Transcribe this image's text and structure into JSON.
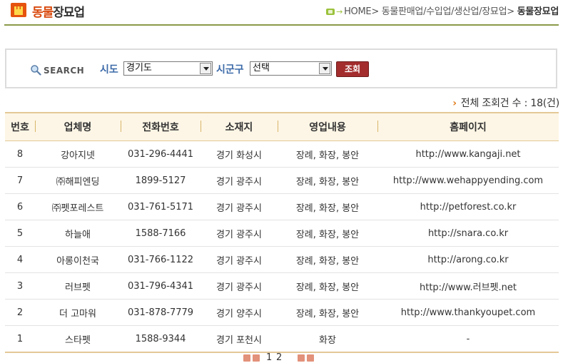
{
  "header": {
    "title_part1": "동물",
    "title_part2": "장묘업",
    "breadcrumb": [
      "HOME",
      "동물판매업/수입업/생산업/장묘업"
    ],
    "breadcrumb_sep": ">",
    "breadcrumb_current": "동물장묘업"
  },
  "search": {
    "label": "SEARCH",
    "sido_label": "시도",
    "sido_value": "경기도",
    "sigungu_label": "시군구",
    "sigungu_value": "선택",
    "submit_label": "조회"
  },
  "count_text": "전체 조회건 수 : 18(건)",
  "table": {
    "columns": [
      "번호",
      "업체명",
      "전화번호",
      "소재지",
      "영업내용",
      "홈페이지"
    ],
    "rows": [
      [
        "8",
        "강아지넷",
        "031-296-4441",
        "경기 화성시",
        "장례, 화장, 봉안",
        "http://www.kangaji.net"
      ],
      [
        "7",
        "㈜해피엔딩",
        "1899-5127",
        "경기 광주시",
        "장례, 화장, 봉안",
        "http://www.wehappyending.com"
      ],
      [
        "6",
        "㈜펫포레스트",
        "031-761-5171",
        "경기 광주시",
        "장례, 화장, 봉안",
        "http://petforest.co.kr"
      ],
      [
        "5",
        "하늘애",
        "1588-7166",
        "경기 광주시",
        "장례, 화장, 봉안",
        "http://snara.co.kr"
      ],
      [
        "4",
        "아롱이천국",
        "031-766-1122",
        "경기 광주시",
        "장례, 화장, 봉안",
        "http://arong.co.kr"
      ],
      [
        "3",
        "러브펫",
        "031-796-4341",
        "경기 광주시",
        "장례, 화장, 봉안",
        "http://www.러브펫.net"
      ],
      [
        "2",
        "더 고마워",
        "031-878-7779",
        "경기 양주시",
        "장례, 화장, 봉안",
        "http://www.thankyoupet.com"
      ],
      [
        "1",
        "스타펫",
        "1588-9344",
        "경기 포천시",
        "화장",
        "-"
      ]
    ]
  },
  "pagination": {
    "pages": [
      "1",
      "2"
    ]
  },
  "colors": {
    "brand_orange": "#e5530e",
    "header_rule": "#8a9a4a",
    "label_blue": "#3c6aa8",
    "button_red": "#a32d2d",
    "table_header_bg": "#fdf6e6"
  }
}
